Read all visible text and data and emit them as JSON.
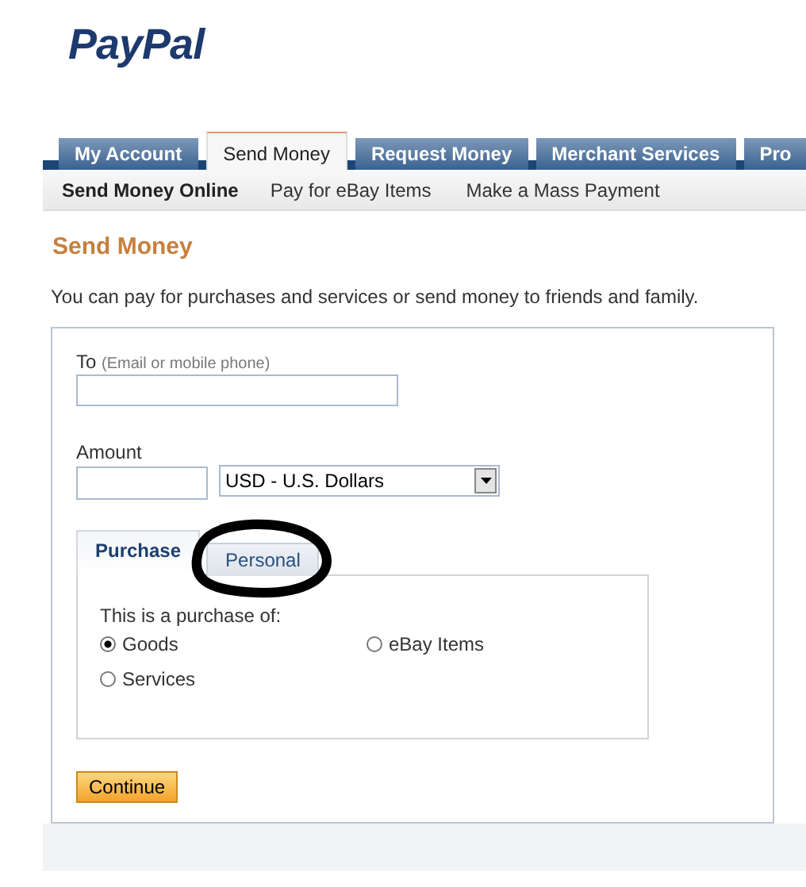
{
  "logo": "PayPal",
  "tabs": [
    {
      "label": "My Account",
      "selected": false
    },
    {
      "label": "Send Money",
      "selected": true
    },
    {
      "label": "Request Money",
      "selected": false
    },
    {
      "label": "Merchant Services",
      "selected": false
    },
    {
      "label": "Pro",
      "selected": false
    }
  ],
  "subnav": [
    {
      "label": "Send Money Online",
      "selected": true
    },
    {
      "label": "Pay for eBay Items",
      "selected": false
    },
    {
      "label": "Make a Mass Payment",
      "selected": false
    }
  ],
  "heading": "Send Money",
  "description": "You can pay for purchases and services or send money to friends and family.",
  "form": {
    "to_label": "To",
    "to_hint": "(Email or mobile phone)",
    "amount_label": "Amount",
    "currency": "USD - U.S. Dollars",
    "payment_tabs": [
      {
        "label": "Purchase",
        "selected": true
      },
      {
        "label": "Personal",
        "selected": false,
        "circled": true
      }
    ],
    "purchase_prompt": "This is a purchase of:",
    "options": [
      {
        "label": "Goods",
        "selected": true
      },
      {
        "label": "eBay Items",
        "selected": false
      },
      {
        "label": "Services",
        "selected": false
      }
    ],
    "continue": "Continue"
  }
}
